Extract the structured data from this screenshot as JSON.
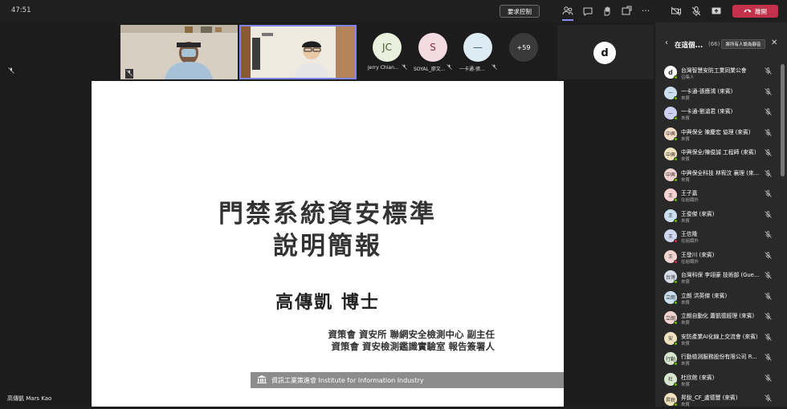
{
  "topbar": {
    "timer": "47:51",
    "request_control_label": "要求控制",
    "leave_label": "離開",
    "icons": [
      "people-icon",
      "chat-icon",
      "raise-hand-icon",
      "share-icon",
      "camera-off-icon",
      "mic-off-icon",
      "share-screen-icon"
    ]
  },
  "stage": {
    "self_mic": "🎤",
    "avatars": [
      {
        "initials": "JC",
        "name": "Jerry Chian...",
        "bg": "#e9f0de",
        "color": "#4a5a2e"
      },
      {
        "initials": "S",
        "name": "SOYAL_廖文...",
        "bg": "#f3dbe2",
        "color": "#8a2d4a"
      },
      {
        "initials": "—",
        "name": "一卡通-張...",
        "bg": "#dcecf2",
        "color": "#2d5f73"
      }
    ],
    "more_count": "+59",
    "logo_letter": "d",
    "presenter_name": "高傳凱 Mars Kao"
  },
  "slide": {
    "title_line1": "門禁系統資安標準",
    "title_line2": "說明簡報",
    "author": "高傳凱 博士",
    "sub_line1": "資策會 資安所 聯網安全檢測中心 副主任",
    "sub_line2": "資策會 資安檢測鑑識實驗室 報告簽署人",
    "footer": "資訊工業策進會 Institute for Information Industry"
  },
  "panel": {
    "title": "在這個...",
    "count": "(66)",
    "mute_all_label": "將所有人設為靜音",
    "participants": [
      {
        "initials": "d",
        "name": "台灣智慧安防工業同業公會",
        "role": "召集人",
        "bg": "#ffffff",
        "dot": "#6bb700"
      },
      {
        "initials": "—",
        "name": "一卡通-張應鴻 (來賓)",
        "role": "來賓",
        "bg": "#cbe0ee",
        "dot": "#6bb700"
      },
      {
        "initials": "—",
        "name": "一卡通-劉滄君 (來賓)",
        "role": "來賓",
        "bg": "#cfd0f1",
        "dot": "#6bb700"
      },
      {
        "initials": "中興",
        "name": "中興保全 陳慶宏 協理 (來賓)",
        "role": "來賓",
        "bg": "#f5ddc8",
        "dot": "#6bb700"
      },
      {
        "initials": "中興",
        "name": "中興保全/陳俊誠 工程師 (來賓)",
        "role": "來賓",
        "bg": "#f1e3c0",
        "dot": "#6bb700"
      },
      {
        "initials": "中興",
        "name": "中興保全科技 林宥汶 襄理 (來...",
        "role": "來賓",
        "bg": "#f3d4d2",
        "dot": "#6bb700"
      },
      {
        "initials": "王",
        "name": "王子嘉",
        "role": "在組織外",
        "bg": "#f3d4d2",
        "dot": "#6bb700"
      },
      {
        "initials": "王",
        "name": "王俊傑 (來賓)",
        "role": "來賓",
        "bg": "#cbe0ee",
        "dot": "#6bb700"
      },
      {
        "initials": "王",
        "name": "王信隆",
        "role": "在組織外",
        "bg": "#cfd6ef",
        "dot": "#c4314b"
      },
      {
        "initials": "王",
        "name": "王發川 (來賓)",
        "role": "在組織外",
        "bg": "#f3d4d2",
        "dot": "#c4314b"
      },
      {
        "initials": "台灣",
        "name": "台灣科保 李翊豪 技術部 (Gue...",
        "role": "來賓",
        "bg": "#d7dde6",
        "dot": "#6bb700"
      },
      {
        "initials": "立朗",
        "name": "立朗 洪英傑 (來賓)",
        "role": "來賓",
        "bg": "#cbe0ee",
        "dot": "#6bb700"
      },
      {
        "initials": "立朗",
        "name": "立朗自動化 蕭凱德經理 (來賓)",
        "role": "來賓",
        "bg": "#f3d4d2",
        "dot": "#6bb700"
      },
      {
        "initials": "安",
        "name": "安防產業AI化線上交流會 (來賓)",
        "role": "來賓",
        "bg": "#f1e3c0",
        "dot": "#6bb700"
      },
      {
        "initials": "行動",
        "name": "行動檢測服務股份有限公司 R...",
        "role": "來賓",
        "bg": "#d8e6cf",
        "dot": "#6bb700"
      },
      {
        "initials": "杜",
        "name": "杜欣館 (來賓)",
        "role": "來賓",
        "bg": "#d8e6cf",
        "dot": "#6bb700"
      },
      {
        "initials": "昇銳",
        "name": "昇銳_CF_盧德豐 (來賓)",
        "role": "來賓",
        "bg": "#f1e3c0",
        "dot": "#6bb700"
      }
    ]
  }
}
